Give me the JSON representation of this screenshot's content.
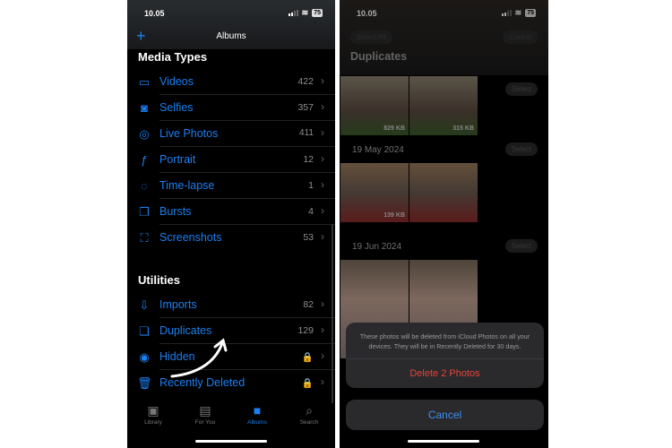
{
  "left": {
    "status": {
      "time": "10.05",
      "battery": "75"
    },
    "nav": {
      "title": "Albums",
      "add_icon": "plus-icon"
    },
    "media_types": {
      "title": "Media Types",
      "items": [
        {
          "label": "Videos",
          "count": "422",
          "icon": "video-icon"
        },
        {
          "label": "Selfies",
          "count": "357",
          "icon": "selfie-icon"
        },
        {
          "label": "Live Photos",
          "count": "411",
          "icon": "live-photo-icon"
        },
        {
          "label": "Portrait",
          "count": "12",
          "icon": "portrait-icon"
        },
        {
          "label": "Time-lapse",
          "count": "1",
          "icon": "timelapse-icon"
        },
        {
          "label": "Bursts",
          "count": "4",
          "icon": "bursts-icon"
        },
        {
          "label": "Screenshots",
          "count": "53",
          "icon": "screenshot-icon"
        }
      ]
    },
    "utilities": {
      "title": "Utilities",
      "items": [
        {
          "label": "Imports",
          "count": "82",
          "icon": "import-icon"
        },
        {
          "label": "Duplicates",
          "count": "129",
          "icon": "duplicates-icon"
        },
        {
          "label": "Hidden",
          "count": "",
          "icon": "hidden-icon",
          "locked": true
        },
        {
          "label": "Recently Deleted",
          "count": "",
          "icon": "trash-icon",
          "locked": true
        }
      ]
    },
    "tabs": [
      {
        "label": "Library"
      },
      {
        "label": "For You"
      },
      {
        "label": "Albums",
        "active": true
      },
      {
        "label": "Search"
      }
    ]
  },
  "right": {
    "status": {
      "time": "10.05",
      "battery": "75"
    },
    "select_all": "Select All",
    "cancel_top": "Cancel",
    "title": "Duplicates",
    "select_label": "Select",
    "groups": [
      {
        "date": "",
        "sizes": [
          "829 KB",
          "315 KB"
        ]
      },
      {
        "date": "19 May 2024",
        "sizes": [
          "139 KB",
          ""
        ]
      },
      {
        "date": "19 Jun 2024",
        "sizes": [
          "",
          ""
        ]
      }
    ],
    "sheet": {
      "message": "These photos will be deleted from iCloud Photos on all your devices. They will be in Recently Deleted for 30 days.",
      "delete": "Delete 2 Photos",
      "cancel": "Cancel"
    }
  },
  "colors": {
    "accent": "#1a7ff0",
    "destructive": "#e5443a"
  }
}
